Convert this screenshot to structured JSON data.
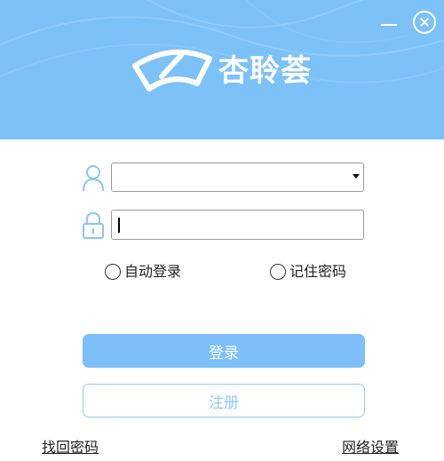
{
  "window": {
    "minimize_icon": "minimize-icon",
    "close_icon": "close-circle-icon"
  },
  "brand": {
    "name": "杏聆荟",
    "logo_icon": "windshield-logo-icon",
    "color": "#7dc1f9"
  },
  "form": {
    "username": {
      "value": "",
      "icon": "user-icon",
      "dropdown_icon": "caret-down-icon"
    },
    "password": {
      "value": "",
      "icon": "lock-icon"
    },
    "auto_login": {
      "label": "自动登录",
      "checked": false
    },
    "remember_password": {
      "label": "记住密码",
      "checked": false
    }
  },
  "buttons": {
    "login": "登录",
    "register": "注册",
    "login_color": "#7cbff9",
    "register_border_color": "#8fcaf9"
  },
  "links": {
    "forgot_password": "找回密码",
    "network_settings": "网络设置"
  }
}
